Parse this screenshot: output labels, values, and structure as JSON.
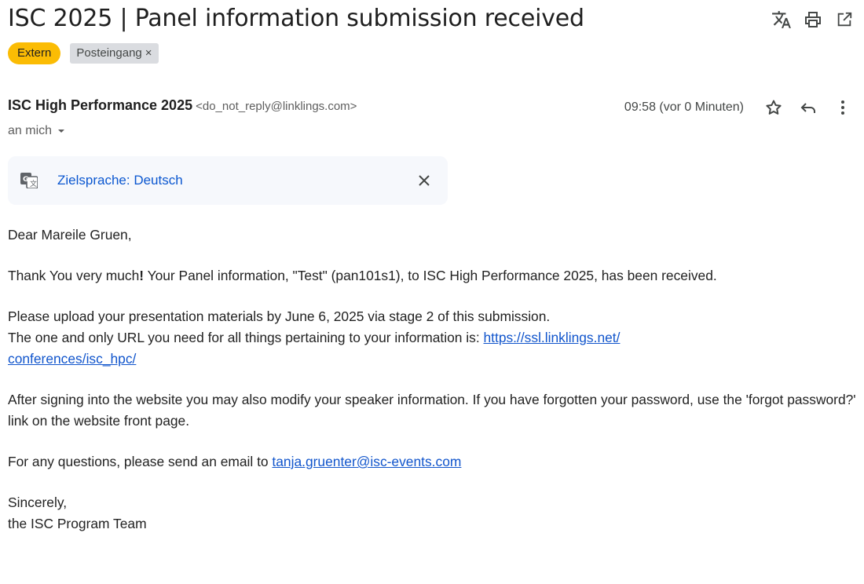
{
  "subject": "ISC 2025 | Panel information submission received",
  "labels": {
    "extern": "Extern",
    "inbox": "Posteingang",
    "inbox_remove": "×"
  },
  "header_actions": {
    "translate_icon": "translate-icon",
    "print_icon": "print-icon",
    "open_new_window_icon": "open-in-new-window-icon"
  },
  "sender": {
    "name": "ISC High Performance 2025",
    "email": "<do_not_reply@linklings.com>",
    "time": "09:58 (vor 0 Minuten)",
    "recipient": "an mich"
  },
  "translate_bar": {
    "link": "Zielsprache: Deutsch"
  },
  "body": {
    "greeting": "Dear Mareile Gruen,",
    "p1_before": "Thank You very much",
    "p1_bang": "!",
    "p1_after": " Your Panel information, \"Test\" (pan101s1), to ISC High Performance 2025, has been received.",
    "p2_line1": "Please upload your presentation materials by June 6, 2025 via stage 2 of this submission.",
    "p2_line2_before": "The one and only URL you need for all things pertaining to your information is: ",
    "p2_link_part1": "https://ssl.linklings.net/",
    "p2_link_part2": "conferences/isc_hpc/",
    "p3": "After signing into the website you may also modify your speaker information. If you have forgotten your password, use the 'forgot password?' link on the website front page.",
    "p4_before": "For any questions, please send an email to ",
    "p4_link": "tanja.gruenter@isc-events.com",
    "closing": "Sincerely,",
    "signature": "the ISC Program Team"
  },
  "colors": {
    "extern_chip": "#fbbc04",
    "label_chip": "#dadce0",
    "link": "#1155cc",
    "translate_link": "#0b57d0",
    "translate_bar_bg": "#f6f8fc"
  }
}
